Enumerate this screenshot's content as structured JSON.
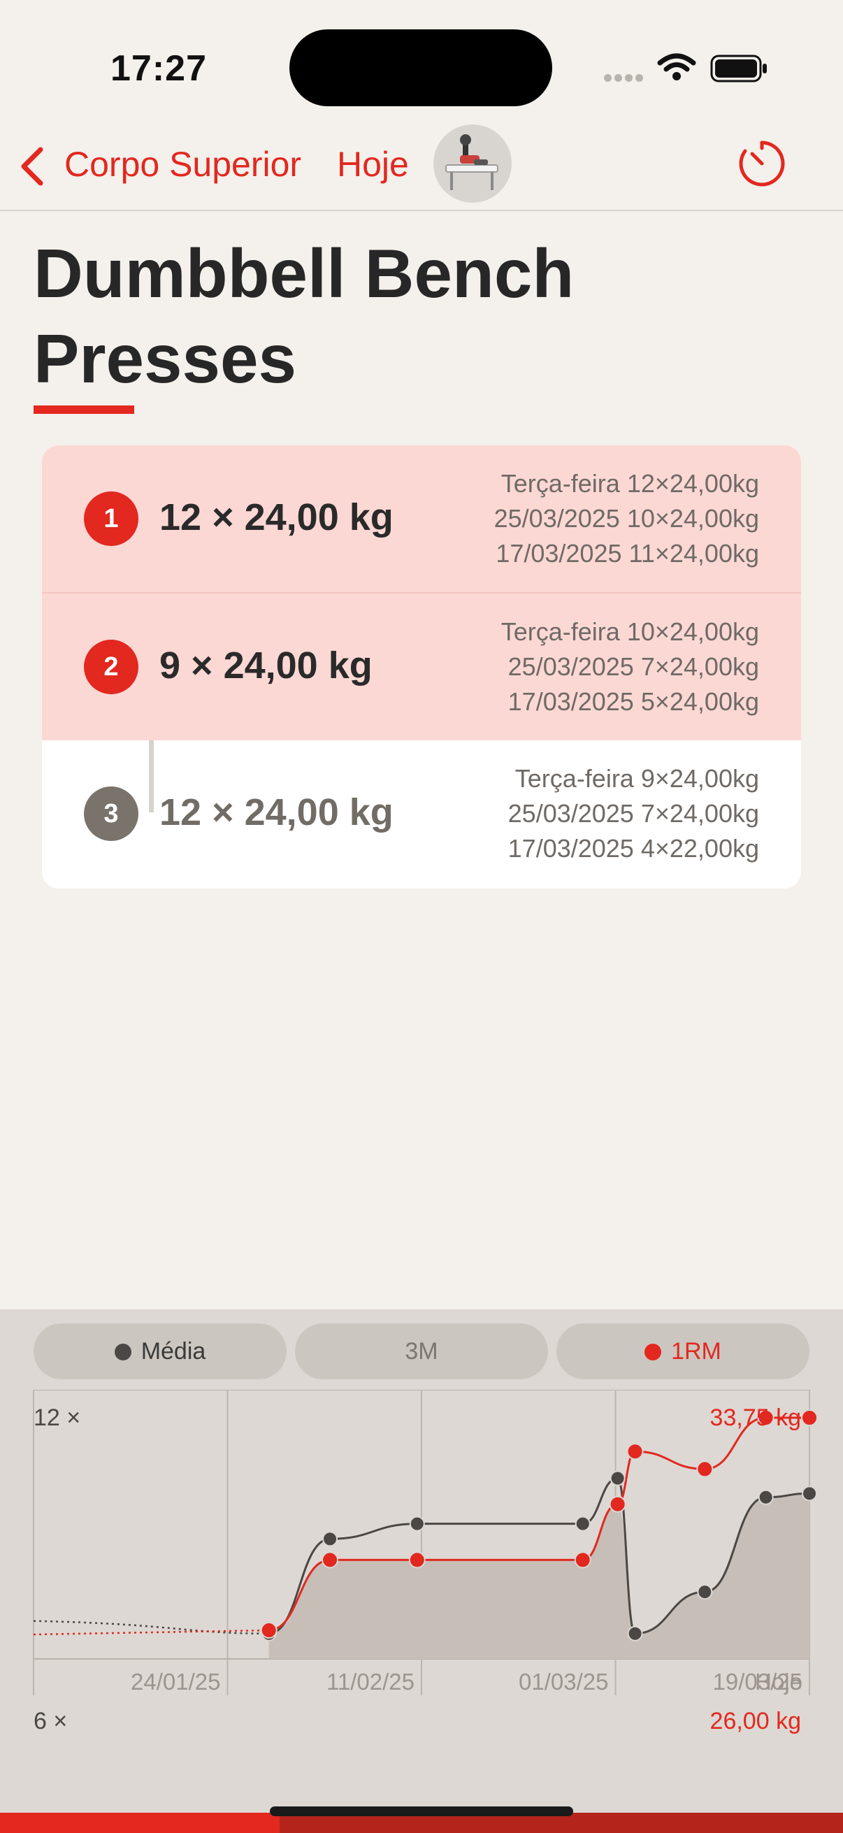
{
  "status_bar": {
    "time": "17:27"
  },
  "nav": {
    "back_label": "Corpo Superior",
    "today_label": "Hoje",
    "timer_icon": "timer-icon",
    "thumbnail_icon": "exercise-thumbnail"
  },
  "title": "Dumbbell Bench Presses",
  "sets": [
    {
      "number": "1",
      "weight_text": "12 × 24,00 kg",
      "status": "done",
      "history": [
        "Terça-feira 12×24,00kg",
        "25/03/2025 10×24,00kg",
        "17/03/2025 11×24,00kg"
      ]
    },
    {
      "number": "2",
      "weight_text": "9 × 24,00 kg",
      "status": "done",
      "history": [
        "Terça-feira 10×24,00kg",
        "25/03/2025 7×24,00kg",
        "17/03/2025 5×24,00kg"
      ]
    },
    {
      "number": "3",
      "weight_text": "12 × 24,00 kg",
      "status": "pending",
      "history": [
        "Terça-feira 9×24,00kg",
        "25/03/2025 7×24,00kg",
        "17/03/2025 4×22,00kg"
      ]
    }
  ],
  "colors": {
    "accent": "#e2281f",
    "done_row": "#fcd8d4",
    "avg_series": "#4a4744",
    "pending_badge": "#7a736b"
  },
  "chart_controls": {
    "avg_label": "Média",
    "range_label": "3M",
    "orm_label": "1RM"
  },
  "chart_data": {
    "type": "line",
    "x_ticks": [
      "24/01/25",
      "11/02/25",
      "01/03/25",
      "19/03/25",
      "Hoje"
    ],
    "left_axis": {
      "top_label": "12 ×",
      "bottom_label": "6 ×"
    },
    "right_axis": {
      "top_label": "33,75 kg",
      "bottom_label": "26,00 kg"
    },
    "series": [
      {
        "name": "Média",
        "color": "#4a4744",
        "points": [
          {
            "x": "2025-02-11",
            "y": 6.3
          },
          {
            "x": "2025-02-18",
            "y": 8.8
          },
          {
            "x": "2025-02-28",
            "y": 9.2
          },
          {
            "x": "2025-03-19",
            "y": 9.2
          },
          {
            "x": "2025-03-23",
            "y": 10.4
          },
          {
            "x": "2025-03-25",
            "y": 6.3
          },
          {
            "x": "2025-04-02",
            "y": 7.4
          },
          {
            "x": "2025-04-09",
            "y": 9.9
          },
          {
            "x": "2025-04-14",
            "y": 10.0
          }
        ]
      },
      {
        "name": "1RM",
        "color": "#e2281f",
        "points": [
          {
            "x": "2025-02-11",
            "y": 26.5
          },
          {
            "x": "2025-02-18",
            "y": 28.9
          },
          {
            "x": "2025-02-28",
            "y": 28.9
          },
          {
            "x": "2025-03-19",
            "y": 28.9
          },
          {
            "x": "2025-03-23",
            "y": 30.8
          },
          {
            "x": "2025-03-25",
            "y": 32.6
          },
          {
            "x": "2025-04-02",
            "y": 32.0
          },
          {
            "x": "2025-04-09",
            "y": 33.75
          },
          {
            "x": "2025-04-14",
            "y": 33.75
          }
        ]
      }
    ],
    "y_left_range": [
      6,
      12
    ],
    "y_right_range": [
      26.0,
      33.75
    ],
    "grid": true
  }
}
